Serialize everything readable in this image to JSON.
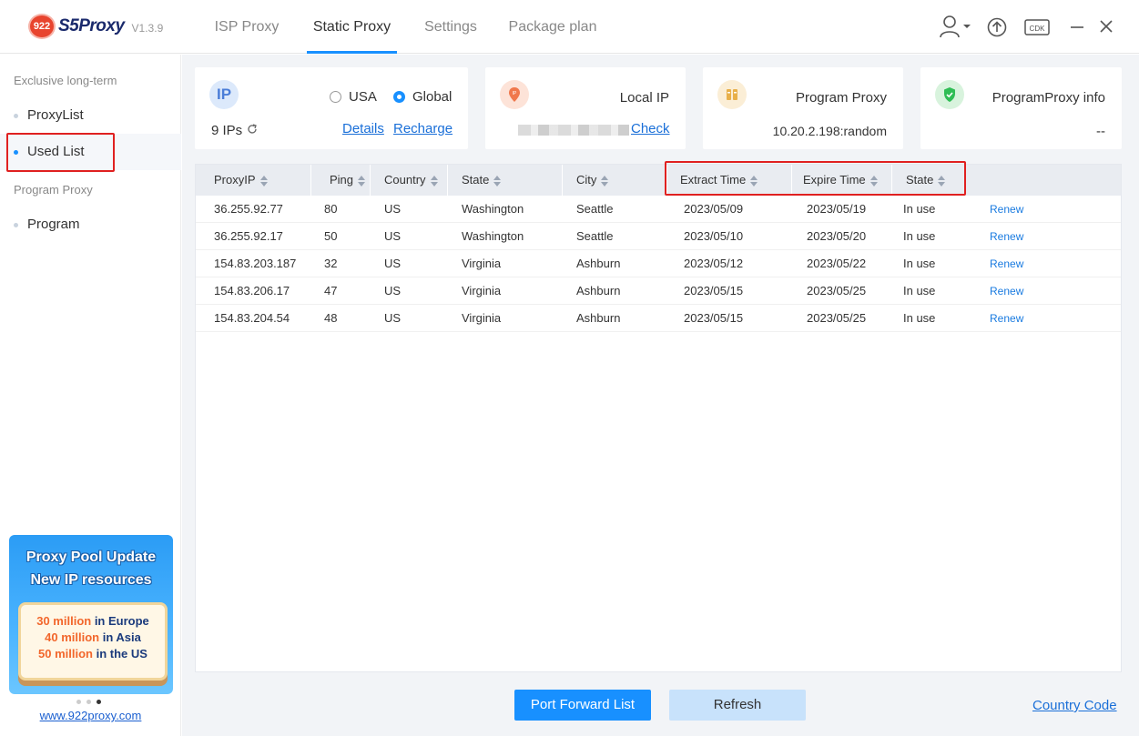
{
  "app": {
    "name": "S5Proxy",
    "badge": "922",
    "version": "V1.3.9"
  },
  "nav": {
    "tabs": [
      {
        "label": "ISP Proxy"
      },
      {
        "label": "Static Proxy"
      },
      {
        "label": "Settings"
      },
      {
        "label": "Package plan"
      }
    ],
    "active_tab": "Static Proxy"
  },
  "toolbar": {
    "cdk_label": "CDK"
  },
  "sidebar": {
    "group1": "Exclusive long-term",
    "items1": [
      {
        "label": "ProxyList"
      },
      {
        "label": "Used List"
      }
    ],
    "group2": "Program Proxy",
    "items2": [
      {
        "label": "Program"
      }
    ],
    "active_item": "Used List",
    "promo": {
      "title1": "Proxy Pool Update",
      "title2": "New IP resources",
      "lines": [
        {
          "hl": "30 million",
          "rest": " in Europe"
        },
        {
          "hl": "40 million",
          "rest": " in Asia"
        },
        {
          "hl": "50 million",
          "rest": " in the US"
        }
      ]
    },
    "site_link": "www.922proxy.com"
  },
  "cards": {
    "ip": {
      "badge": "IP",
      "count": "9 IPs",
      "radio_usa": "USA",
      "radio_global": "Global",
      "selected": "Global",
      "details": "Details",
      "recharge": "Recharge"
    },
    "local": {
      "title": "Local IP",
      "check": "Check"
    },
    "program": {
      "title": "Program Proxy",
      "value": "10.20.2.198:random"
    },
    "info": {
      "title": "ProgramProxy info",
      "value": "--"
    }
  },
  "table": {
    "headers": [
      "ProxyIP",
      "Ping",
      "Country",
      "State",
      "City",
      "Extract Time",
      "Expire Time",
      "State"
    ],
    "rows": [
      {
        "ip": "36.255.92.77",
        "ping": "80",
        "country": "US",
        "state": "Washington",
        "city": "Seattle",
        "extract": "2023/05/09",
        "expire": "2023/05/19",
        "status": "In use",
        "action": "Renew"
      },
      {
        "ip": "36.255.92.17",
        "ping": "50",
        "country": "US",
        "state": "Washington",
        "city": "Seattle",
        "extract": "2023/05/10",
        "expire": "2023/05/20",
        "status": "In use",
        "action": "Renew"
      },
      {
        "ip": "154.83.203.187",
        "ping": "32",
        "country": "US",
        "state": "Virginia",
        "city": "Ashburn",
        "extract": "2023/05/12",
        "expire": "2023/05/22",
        "status": "In use",
        "action": "Renew"
      },
      {
        "ip": "154.83.206.17",
        "ping": "47",
        "country": "US",
        "state": "Virginia",
        "city": "Ashburn",
        "extract": "2023/05/15",
        "expire": "2023/05/25",
        "status": "In use",
        "action": "Renew"
      },
      {
        "ip": "154.83.204.54",
        "ping": "48",
        "country": "US",
        "state": "Virginia",
        "city": "Ashburn",
        "extract": "2023/05/15",
        "expire": "2023/05/25",
        "status": "In use",
        "action": "Renew"
      }
    ]
  },
  "footer": {
    "port_forward": "Port Forward List",
    "refresh": "Refresh",
    "country_code": "Country Code"
  },
  "colors": {
    "accent": "#1890ff",
    "highlight_box": "#e02020",
    "promo_orange": "#f2662b"
  }
}
